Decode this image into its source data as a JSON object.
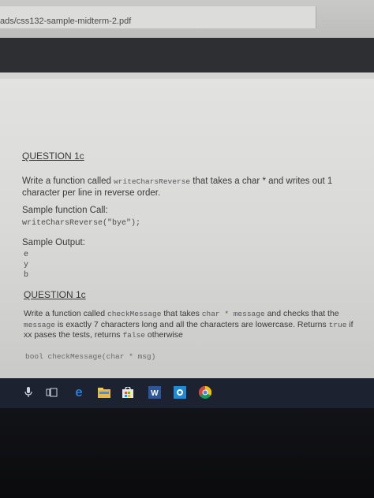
{
  "browser": {
    "address": "ads/css132-sample-midterm-2.pdf"
  },
  "doc": {
    "q1": {
      "heading": "QUESTION 1c",
      "pre": "Write a function called ",
      "func": "writeCharsReverse",
      "post": " that takes a char * and writes out 1 character per line in reverse order.",
      "call_label": "Sample function Call:",
      "call_code": "writeCharsReverse(\"bye\");",
      "output_label": "Sample Output:",
      "output_lines": [
        "e",
        "y",
        "b"
      ]
    },
    "q2": {
      "heading": "QUESTION 1c",
      "t1": "Write a function called ",
      "c1": "checkMessage",
      "t2": " that takes ",
      "c2": "char * message",
      "t3": " and checks that the ",
      "c3": "message",
      "t4": " is exactly 7 characters long and all the characters are lowercase. Returns ",
      "c4": "true",
      "t5": " if xx pases the tests, returns ",
      "c5": "false",
      "t6": " otherwise",
      "signature": "bool checkMessage(char * msg)"
    }
  },
  "taskbar": {
    "icons": [
      "microphone-icon",
      "task-view-icon",
      "edge-icon",
      "file-explorer-icon",
      "store-icon",
      "word-icon",
      "photos-icon",
      "chrome-icon"
    ],
    "colors": {
      "edge": "#2b7bd4",
      "word": "#2b579a",
      "store": "#e8e8e8",
      "chrome_red": "#db4437",
      "chrome_yellow": "#f4c20d",
      "chrome_green": "#0f9d58"
    }
  }
}
